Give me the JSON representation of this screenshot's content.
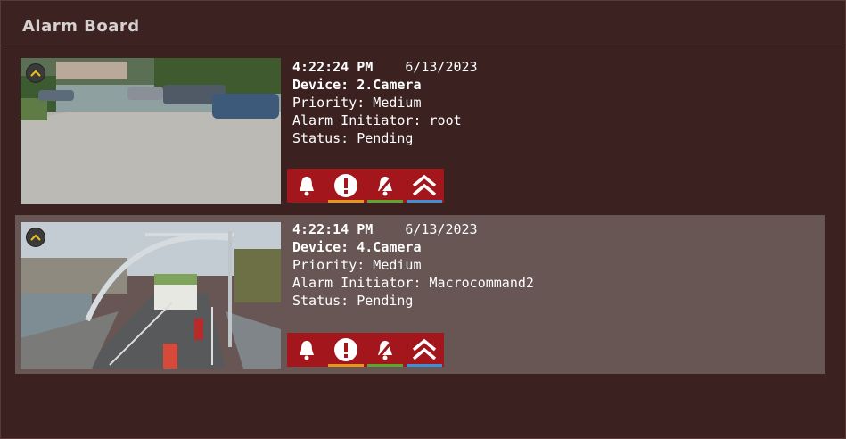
{
  "board": {
    "title": "Alarm Board"
  },
  "alarms": [
    {
      "time": "4:22:24 PM",
      "date": "6/13/2023",
      "device": "Device: 2.Camera",
      "priority": "Priority: Medium",
      "initiator": "Alarm Initiator: root",
      "status": "Status: Pending"
    },
    {
      "time": "4:22:14 PM",
      "date": "6/13/2023",
      "device": "Device: 4.Camera",
      "priority": "Priority: Medium",
      "initiator": "Alarm Initiator: Macrocommand2",
      "status": "Status: Pending"
    }
  ],
  "actions": [
    {
      "icon": "bell-icon",
      "underline": "none"
    },
    {
      "icon": "exclamation-icon",
      "underline": "#e8951a"
    },
    {
      "icon": "bell-muted-icon",
      "underline": "#5ea52e"
    },
    {
      "icon": "double-chevron-up-icon",
      "underline": "#3f8fd4"
    }
  ],
  "colors": {
    "background": "#3b2221",
    "selected_card": "#675654",
    "action_button": "#a3161b"
  }
}
